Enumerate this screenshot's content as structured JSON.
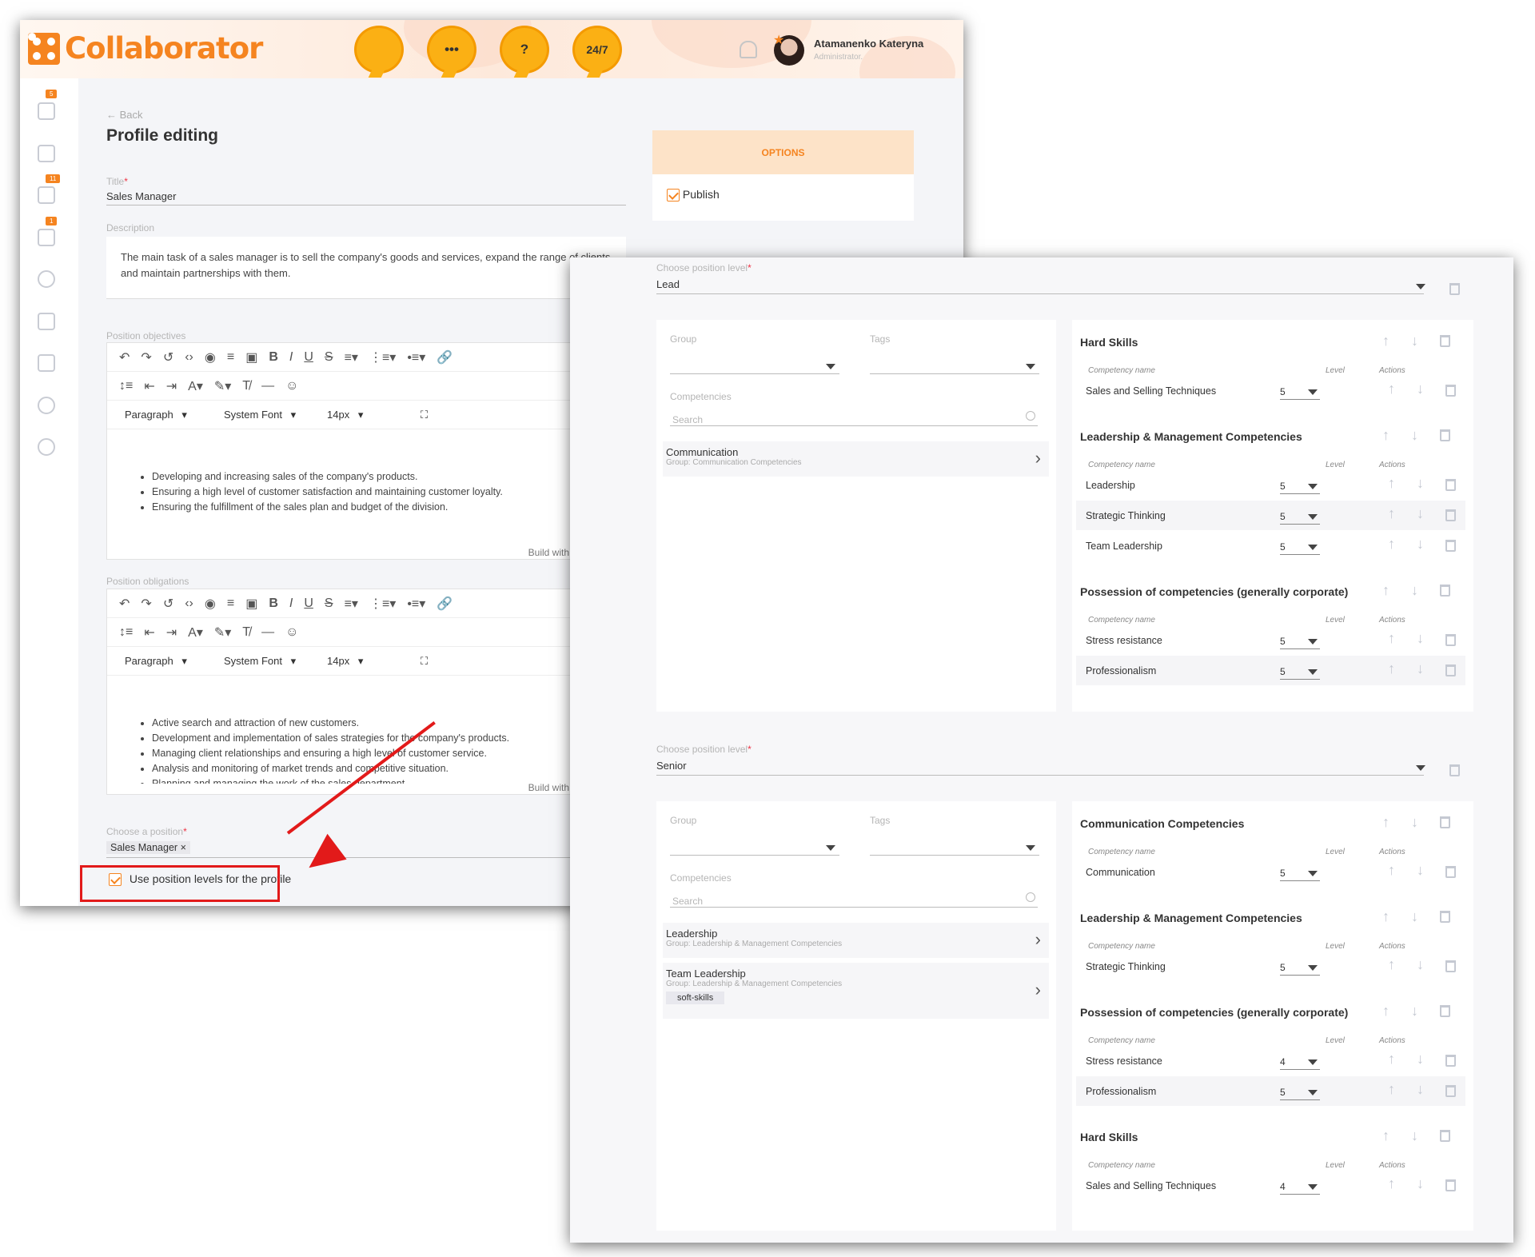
{
  "app": {
    "logo": "Collaborator",
    "support": {
      "b1": "",
      "b2": "•••",
      "b3": "?",
      "b4": "24/7"
    },
    "user": {
      "name": "Atamanenko Kateryna",
      "role": "Administrator."
    },
    "badges": [
      "5",
      "11",
      "1"
    ]
  },
  "page": {
    "back": "Back",
    "title": "Profile editing"
  },
  "form": {
    "title_label": "Title",
    "title_value": "Sales Manager",
    "desc_label": "Description",
    "desc_value": "The main task of a sales manager is to sell the company's goods and services, expand the range of clients and maintain partnerships with them.",
    "obj_label": "Position objectives",
    "obl_label": "Position obligations",
    "toolbar": {
      "paragraph": "Paragraph",
      "font": "System Font",
      "size": "14px",
      "build": "Build with"
    },
    "objectives": [
      "Developing and increasing sales of the company's products.",
      "Ensuring a high level of customer satisfaction and maintaining customer loyalty.",
      "Ensuring the fulfillment of the sales plan and budget of the division."
    ],
    "obligations": [
      "Active search and attraction of new customers.",
      "Development and implementation of sales strategies for the company's products.",
      "Managing client relationships and ensuring a high level of customer service.",
      "Analysis and monitoring of market trends and competitive situation.",
      "Planning and managing the work of the sales department."
    ],
    "position_label": "Choose a position",
    "position_chip": "Sales Manager",
    "chip_x": "×",
    "use_levels": "Use position levels for the profile"
  },
  "options": {
    "header": "OPTIONS",
    "publish": "Publish"
  },
  "levels": {
    "label": "Choose position level",
    "group": "Group",
    "tags": "Tags",
    "competencies": "Competencies",
    "search": "Search",
    "cn": "Competency name",
    "lvl": "Level",
    "act": "Actions",
    "lead": {
      "value": "Lead",
      "list": [
        {
          "name": "Communication",
          "group": "Group: Communication Competencies"
        }
      ],
      "groups": [
        {
          "title": "Hard Skills",
          "rows": [
            {
              "name": "Sales and Selling Techniques",
              "level": "5"
            }
          ]
        },
        {
          "title": "Leadership & Management Competencies",
          "rows": [
            {
              "name": "Leadership",
              "level": "5"
            },
            {
              "name": "Strategic Thinking",
              "level": "5"
            },
            {
              "name": "Team Leadership",
              "level": "5"
            }
          ]
        },
        {
          "title": "Possession of competencies (generally corporate)",
          "rows": [
            {
              "name": "Stress resistance",
              "level": "5"
            },
            {
              "name": "Professionalism",
              "level": "5"
            }
          ]
        }
      ]
    },
    "senior": {
      "value": "Senior",
      "list": [
        {
          "name": "Leadership",
          "group": "Group: Leadership & Management Competencies"
        },
        {
          "name": "Team Leadership",
          "group": "Group: Leadership & Management Competencies",
          "tag": "soft-skills"
        }
      ],
      "groups": [
        {
          "title": "Communication Competencies",
          "rows": [
            {
              "name": "Communication",
              "level": "5"
            }
          ]
        },
        {
          "title": "Leadership & Management Competencies",
          "rows": [
            {
              "name": "Strategic Thinking",
              "level": "5"
            }
          ]
        },
        {
          "title": "Possession of competencies (generally corporate)",
          "rows": [
            {
              "name": "Stress resistance",
              "level": "4"
            },
            {
              "name": "Professionalism",
              "level": "5"
            }
          ]
        },
        {
          "title": "Hard Skills",
          "rows": [
            {
              "name": "Sales and Selling Techniques",
              "level": "4"
            }
          ]
        }
      ]
    }
  },
  "colors": {
    "accent": "#f58420",
    "highlight": "#e21a1a"
  }
}
